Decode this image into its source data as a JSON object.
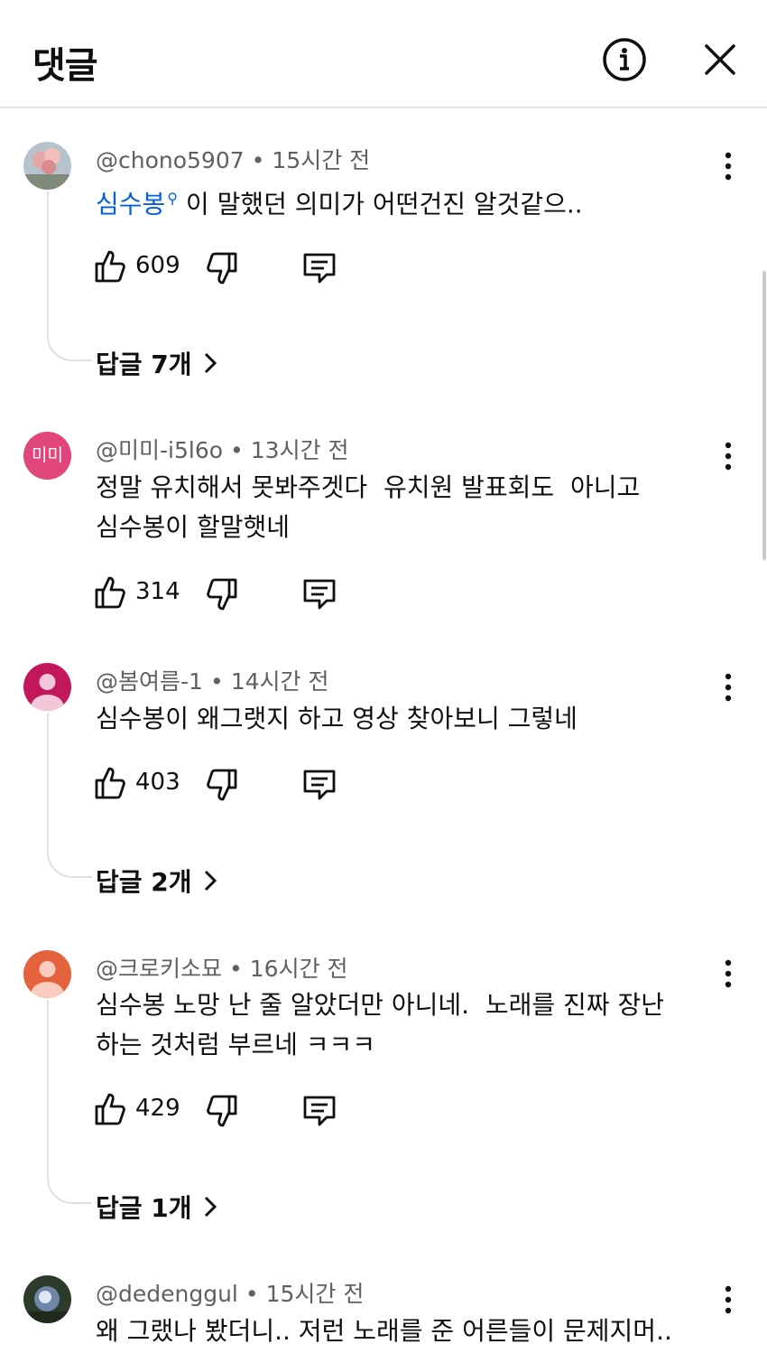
{
  "header": {
    "title": "댓글",
    "info_icon": "info-circle-icon",
    "close_icon": "close-icon"
  },
  "comments": [
    {
      "author": "@chono5907",
      "time": "15시간 전",
      "mention": "심수봉",
      "text_after_mention": "이 말했던 의미가 어떤건진 알것같으..",
      "likes": "609",
      "replies_label": "답글 7개"
    },
    {
      "author": "@미미-i5l6o",
      "time": "13시간 전",
      "avatar_text": "미미",
      "text": "정말 유치해서 못봐주겟다  유치원 발표회도  아니고 심수봉이 할말햇네",
      "likes": "314"
    },
    {
      "author": "@봄여름-1",
      "time": "14시간 전",
      "text": "심수봉이 왜그랫지 하고 영상 찾아보니 그렇네",
      "likes": "403",
      "replies_label": "답글 2개"
    },
    {
      "author": "@크로키소묘",
      "time": "16시간 전",
      "text": "심수봉 노망 난 줄 알았더만 아니네.  노래를 진짜 장난 하는 것처럼 부르네 ㅋㅋㅋ",
      "likes": "429",
      "replies_label": "답글 1개"
    },
    {
      "author": "@dedenggul",
      "time": "15시간 전",
      "text": "왜 그랬나 봤더니..  저런 노래를 준 어른들이 문제지머.."
    }
  ],
  "colors": {
    "mention": "#065fd4",
    "avatar_mimi": "#e0457b",
    "avatar_spring": "#c2185b",
    "avatar_croqui": "#e4633c",
    "meta_text": "#606060"
  }
}
